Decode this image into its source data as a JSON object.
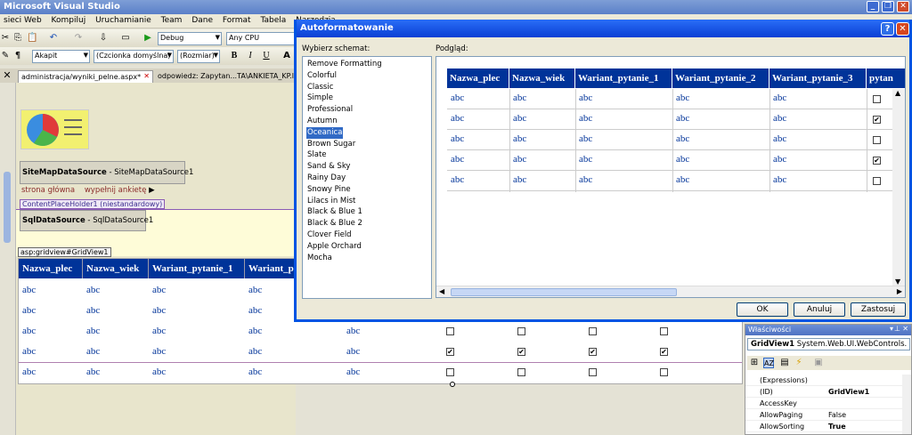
{
  "app": {
    "title": "Microsoft Visual Studio"
  },
  "menu": [
    "sieci Web",
    "Kompiluj",
    "Uruchamianie",
    "Team",
    "Dane",
    "Format",
    "Tabela",
    "Narzędzia"
  ],
  "toolbar": {
    "config": "Debug",
    "platform": "Any CPU",
    "block_format": "Akapit",
    "font": "(Czcionka domyślna)",
    "size": "(Rozmiar)"
  },
  "tabs": {
    "active": "administracja/wyniki_pelne.aspx*",
    "other": "odpowiedz: Zapytan...TA\\ANKIETA_KP.l"
  },
  "designer": {
    "sitemap_title": "SiteMapDataSource",
    "sitemap_id": " - SiteMapDataSource1",
    "nav_home": "strona główna",
    "nav_fill": "wypełnij ankietę",
    "placeholder": "ContentPlaceHolder1 (niestandardowy)",
    "sql_title": "SqlDataSource",
    "sql_id": " - SqlDataSource1",
    "grid_tag": "asp:gridview#GridView1"
  },
  "maingrid": {
    "headers": [
      "Nazwa_plec",
      "Nazwa_wiek",
      "Wariant_pytanie_1",
      "Wariant_p"
    ],
    "cell": "abc",
    "checks": [
      [
        false,
        false,
        false,
        false
      ],
      [
        true,
        true,
        true,
        true
      ],
      [
        false,
        false,
        false,
        false
      ]
    ]
  },
  "dialog": {
    "title": "Autoformatowanie",
    "scheme_label": "Wybierz schemat:",
    "preview_label": "Podgląd:",
    "schemes": [
      "Remove Formatting",
      "Colorful",
      "Classic",
      "Simple",
      "Professional",
      "Autumn",
      "Oceanica",
      "Brown Sugar",
      "Slate",
      "Sand & Sky",
      "Rainy Day",
      "Snowy Pine",
      "Lilacs in Mist",
      "Black & Blue 1",
      "Black & Blue 2",
      "Clover Field",
      "Apple Orchard",
      "Mocha"
    ],
    "selected": "Oceanica",
    "preview_headers": [
      "Nazwa_plec",
      "Nazwa_wiek",
      "Wariant_pytanie_1",
      "Wariant_pytanie_2",
      "Wariant_pytanie_3",
      "pytan"
    ],
    "preview_cell": "abc",
    "preview_checks": [
      false,
      true,
      false,
      true,
      false
    ],
    "ok": "OK",
    "cancel": "Anuluj",
    "apply": "Zastosuj"
  },
  "properties": {
    "title": "Właściwości",
    "object": "GridView1",
    "object_type": "System.Web.UI.WebControls.",
    "rows": [
      {
        "k": "(Expressions)",
        "v": ""
      },
      {
        "k": "(ID)",
        "v": "GridView1"
      },
      {
        "k": "AccessKey",
        "v": ""
      },
      {
        "k": "AllowPaging",
        "v": "False"
      },
      {
        "k": "AllowSorting",
        "v": "True"
      }
    ]
  },
  "colors": {
    "accent": "#003399",
    "title": "#0a3fd4",
    "selection": "#316ac5"
  }
}
